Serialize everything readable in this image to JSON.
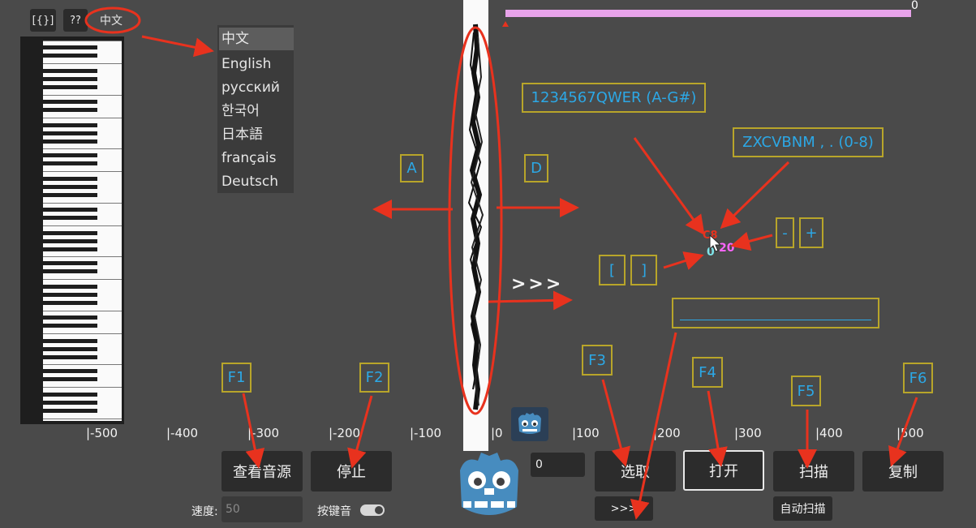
{
  "toolbar": {
    "json_label": "[{}]",
    "help_label": "??",
    "lang_label": "中文"
  },
  "language_menu": [
    "中文",
    "English",
    "русский",
    "한국어",
    "日本語",
    "français",
    "Deutsch"
  ],
  "progress": {
    "value_label": "0",
    "fraction": 1.0,
    "color": "#e8a3ea"
  },
  "axis": {
    "ticks": [
      "|-500",
      "|-400",
      "|-300",
      "|-200",
      "|-100",
      "|0",
      "|100",
      "|200",
      "|300",
      "|400",
      "|500"
    ]
  },
  "hints": {
    "keys_notes": "1234567QWER (A-G#)",
    "keys_octave": "ZXCVBNM , . (0-8)",
    "left_key": "A",
    "right_key": "D",
    "forward": ">>>",
    "minus": "-",
    "plus": "+",
    "bracket_left": "[",
    "bracket_right": "]",
    "f1": "F1",
    "f2": "F2",
    "f3": "F3",
    "f4": "F4",
    "f5": "F5",
    "f6": "F6"
  },
  "cursor_readout": {
    "note": "C8",
    "octave_value": "20",
    "offset_value": "0"
  },
  "controls": {
    "view_source": "查看音源",
    "stop": "停止",
    "speed_label": "速度:",
    "speed_placeholder": "50",
    "key_sound_label": "按键音",
    "position_value": "0",
    "select": "选取",
    "forward_small": ">>>",
    "open": "打开",
    "scan": "扫描",
    "auto_scan": "自动扫描",
    "copy": "复制"
  },
  "colors": {
    "annotation_red": "#e8321e",
    "hint_blue": "#2ca8e6",
    "hint_box": "#b8a52a",
    "note_pink": "#ff66ff",
    "note_cyan": "#7fe3e8"
  }
}
